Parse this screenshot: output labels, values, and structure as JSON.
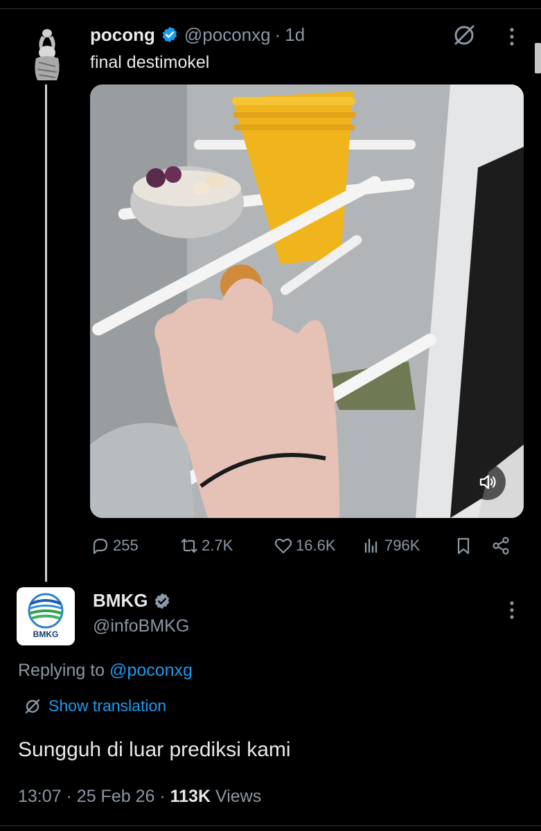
{
  "tweet1": {
    "display_name": "pocong",
    "handle": "@poconxg",
    "separator": "·",
    "time": "1d",
    "text": "final destimokel",
    "media": {
      "type": "video",
      "description_icon": "speaker-icon"
    },
    "actions": {
      "replies": "255",
      "reposts": "2.7K",
      "likes": "16.6K",
      "views": "796K"
    }
  },
  "tweet2": {
    "display_name": "BMKG",
    "handle": "@infoBMKG",
    "avatar_text": "BMKG",
    "replying_prefix": "Replying to",
    "replying_handle": "@poconxg",
    "show_translation": "Show translation",
    "text": "Sungguh di luar prediksi kami",
    "time": "13:07",
    "dot1": "·",
    "date": "25 Feb 26",
    "dot2": "·",
    "views_count": "113K",
    "views_label": "Views"
  },
  "colors": {
    "background": "#000000",
    "text": "#e7e9ea",
    "muted": "#8b98a5",
    "accent": "#1d9bf0",
    "cup_yellow": "#f0b41c"
  }
}
